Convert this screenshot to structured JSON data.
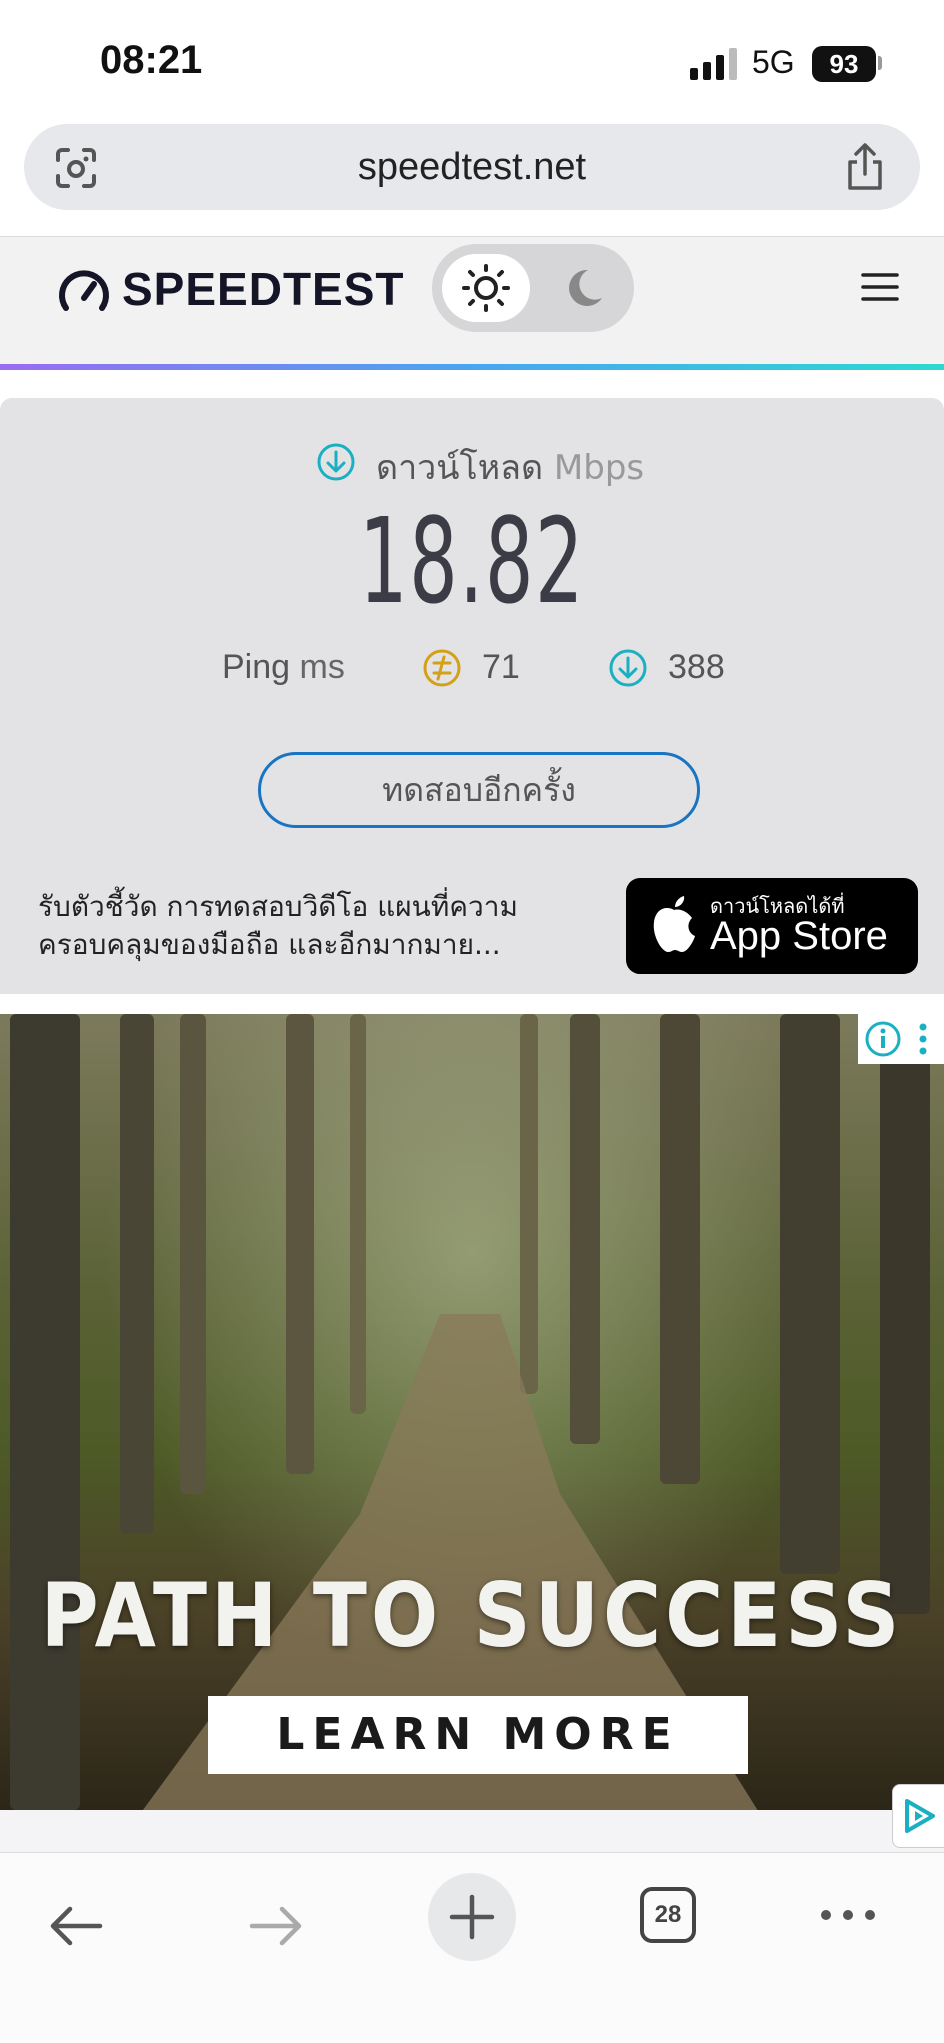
{
  "status_bar": {
    "time": "08:21",
    "network": "5G",
    "battery": "93",
    "signal_icon": "signal-bars-icon"
  },
  "browser": {
    "url": "speedtest.net",
    "lens_icon": "camera-lens-icon",
    "share_icon": "share-icon",
    "toolbar": {
      "back_icon": "back-arrow-icon",
      "forward_icon": "forward-arrow-icon",
      "new_tab_icon": "plus-icon",
      "tab_count": "28",
      "more_icon": "more-dots-icon"
    }
  },
  "site": {
    "logo_text": "SPEEDTEST",
    "theme_toggle": {
      "light_icon": "sun-icon",
      "dark_icon": "moon-icon",
      "selected": "light"
    },
    "menu_icon": "hamburger-menu-icon",
    "gradient_colors": [
      "#9a6cf1",
      "#4aa5f0",
      "#2cd9d0"
    ]
  },
  "result": {
    "download_label": "ดาวน์โหลด",
    "download_unit": "Mbps",
    "download_value": "18.82",
    "ping_label": "Ping",
    "ping_unit": "ms",
    "ping_jitter_value": "71",
    "ping_latency_value": "388",
    "accent_teal": "#1ab0c2",
    "accent_gold": "#d4a017"
  },
  "retest_button": "ทดสอบอีกครั้ง",
  "promo": {
    "text": "รับตัวชี้วัด การทดสอบวิดีโอ แผนที่ความครอบคลุมของมือถือ และอีกมากมาย...",
    "appstore_small": "ดาวน์โหลดได้ที่",
    "appstore_big": "App Store"
  },
  "ad": {
    "headline": "PATH TO SUCCESS",
    "cta": "LEARN MORE",
    "info_icon": "info-icon",
    "more_icon": "vertical-dots-icon",
    "adchoices_icon": "adchoices-icon"
  }
}
